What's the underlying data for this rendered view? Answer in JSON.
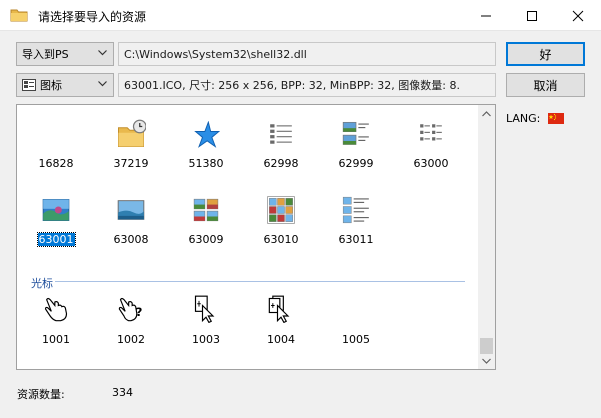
{
  "window": {
    "title": "请选择要导入的资源",
    "icon": "folder-icon",
    "controls": [
      "minimize-icon",
      "maximize-icon",
      "close-icon"
    ]
  },
  "import_target": {
    "selected": "导入到PS"
  },
  "path": {
    "value": "C:\\Windows\\System32\\shell32.dll"
  },
  "resource_type": {
    "selected": "图标",
    "icon": "image-type-icon"
  },
  "details": {
    "value": "63001.ICO, 尺寸: 256 x 256, BPP: 32, MinBPP: 32, 图像数量: 8."
  },
  "buttons": {
    "ok": "好",
    "cancel": "取消"
  },
  "lang": {
    "label": "LANG:",
    "flag_color": "#de2910"
  },
  "icons_section": {
    "items": [
      {
        "id": "16828",
        "icon": "blank"
      },
      {
        "id": "37219",
        "icon": "folder-clock-icon"
      },
      {
        "id": "51380",
        "icon": "blue-star-icon"
      },
      {
        "id": "62998",
        "icon": "details-list-icon"
      },
      {
        "id": "62999",
        "icon": "image-list-icon"
      },
      {
        "id": "63000",
        "icon": "small-icons-view-icon"
      },
      {
        "id": "63001",
        "icon": "landscape-photo-icon",
        "selected": true
      },
      {
        "id": "63008",
        "icon": "landscape-photo-icon"
      },
      {
        "id": "63009",
        "icon": "photo-grid-icon"
      },
      {
        "id": "63010",
        "icon": "photo-grid-large-icon"
      },
      {
        "id": "63011",
        "icon": "photo-list-icon"
      }
    ]
  },
  "cursors_section": {
    "title": "光标",
    "items": [
      {
        "id": "1001",
        "icon": "hand-cursor-icon"
      },
      {
        "id": "1002",
        "icon": "hand-help-cursor-icon"
      },
      {
        "id": "1003",
        "icon": "document-arrow-cursor-icon"
      },
      {
        "id": "1004",
        "icon": "documents-arrow-cursor-icon"
      },
      {
        "id": "1005",
        "icon": "blank"
      }
    ]
  },
  "status": {
    "label": "资源数量:",
    "value": "334"
  }
}
